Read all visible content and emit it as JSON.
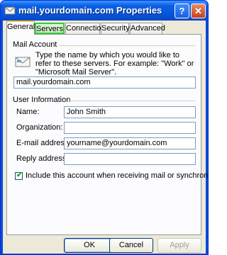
{
  "window": {
    "title": "mail.yourdomain.com Properties"
  },
  "tabs": [
    {
      "label": "General"
    },
    {
      "label": "Servers"
    },
    {
      "label": "Connection"
    },
    {
      "label": "Security"
    },
    {
      "label": "Advanced"
    }
  ],
  "mail_account": {
    "group_label": "Mail Account",
    "description": "Type the name by which you would like to refer to these servers.  For example: \"Work\" or \"Microsoft Mail Server\".",
    "account_name": "mail.yourdomain.com"
  },
  "user_info": {
    "group_label": "User Information",
    "name_label": "Name:",
    "name_value": "John Smith",
    "organization_label": "Organization:",
    "organization_value": "",
    "email_label": "E-mail address:",
    "email_value": "yourname@yourdomain.com",
    "reply_label": "Reply address:",
    "reply_value": ""
  },
  "include_checkbox": {
    "label": "Include this account when receiving mail or synchronizing",
    "checked": true
  },
  "buttons": {
    "ok": "OK",
    "cancel": "Cancel",
    "apply": "Apply"
  },
  "title_buttons": {
    "help": "?",
    "close": "✕"
  }
}
